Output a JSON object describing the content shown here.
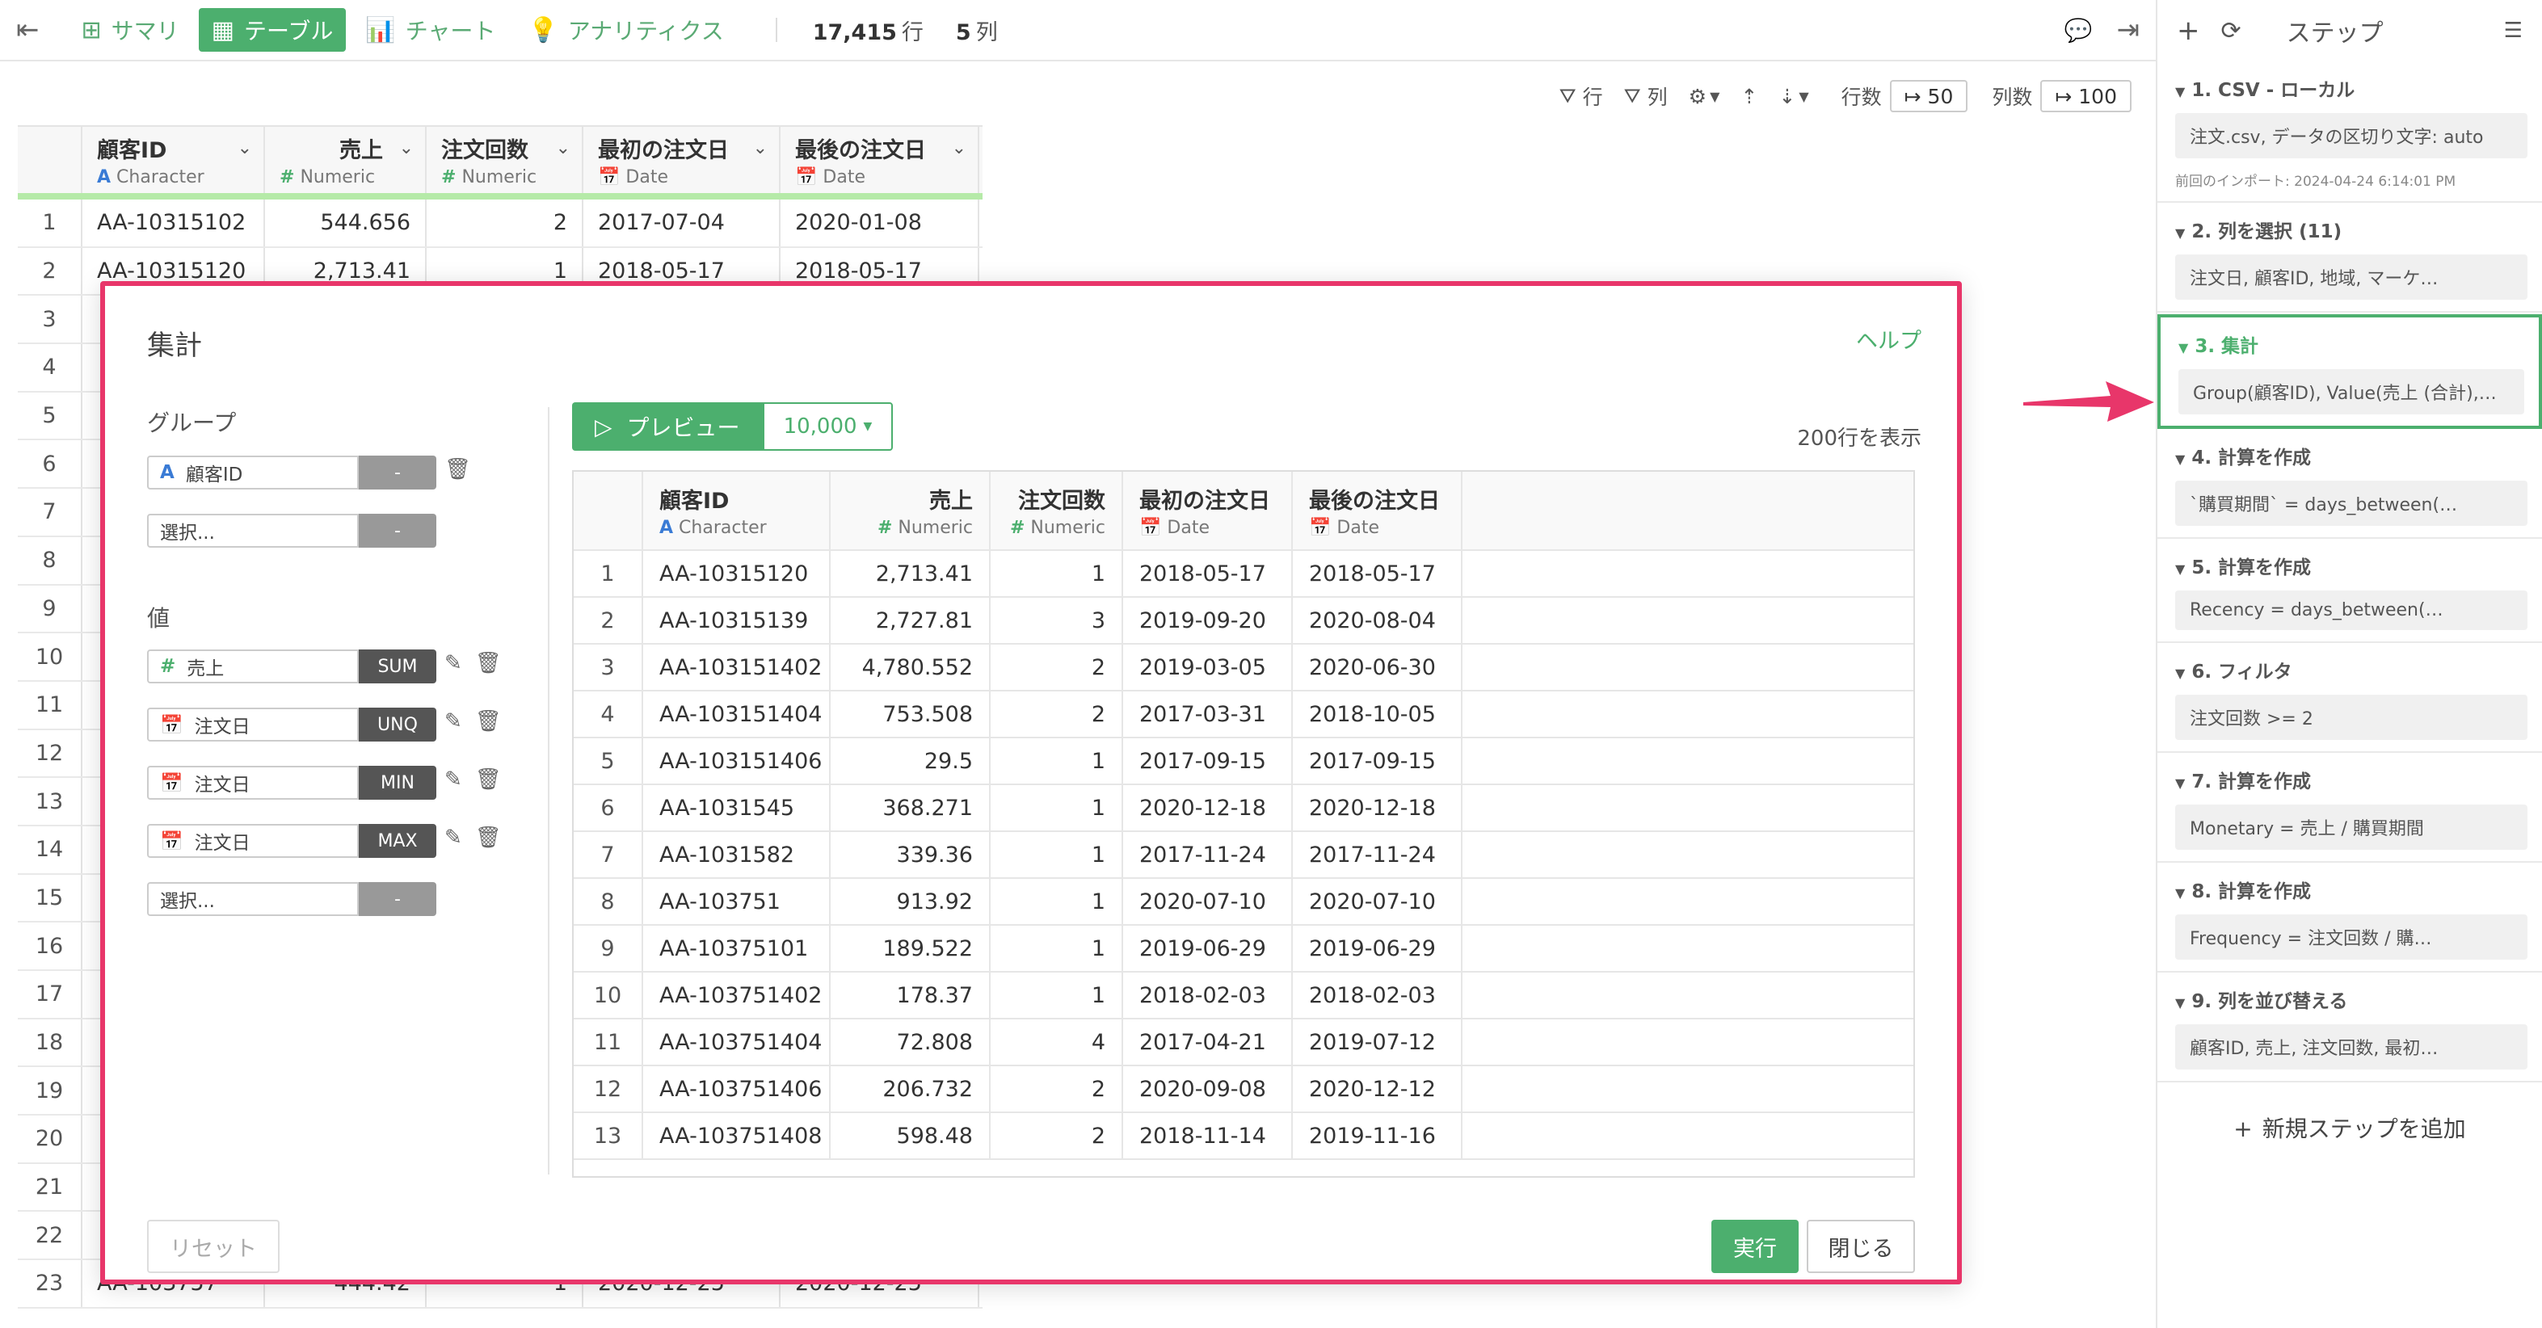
{
  "topbar": {
    "tabs": [
      {
        "icon": "table-grid-icon",
        "label": "サマリ"
      },
      {
        "icon": "table-icon",
        "label": "テーブル"
      },
      {
        "icon": "bar-chart-icon",
        "label": "チャート"
      },
      {
        "icon": "lightbulb-icon",
        "label": "アナリティクス"
      }
    ],
    "rows_count": "17,415",
    "rows_unit": "行",
    "cols_count": "5",
    "cols_unit": "列"
  },
  "toolbar": {
    "row_filter": "行",
    "col_filter": "列",
    "rows_label": "行数",
    "rows_value": "↦ 50",
    "cols_label": "列数",
    "cols_value": "↦ 100"
  },
  "bg_table": {
    "columns": [
      {
        "name": "顧客ID",
        "type": "Character",
        "type_icon": "A"
      },
      {
        "name": "売上",
        "type": "Numeric",
        "type_icon": "#"
      },
      {
        "name": "注文回数",
        "type": "Numeric",
        "type_icon": "#"
      },
      {
        "name": "最初の注文日",
        "type": "Date",
        "type_icon": "📅"
      },
      {
        "name": "最後の注文日",
        "type": "Date",
        "type_icon": "📅"
      }
    ],
    "rows": [
      [
        "1",
        "AA-10315102",
        "544.656",
        "2",
        "2017-07-04",
        "2020-01-08"
      ],
      [
        "2",
        "AA-10315120",
        "2,713.41",
        "1",
        "2018-05-17",
        "2018-05-17"
      ],
      [
        "3",
        "",
        "",
        "",
        "",
        ""
      ],
      [
        "4",
        "",
        "",
        "",
        "",
        ""
      ],
      [
        "5",
        "",
        "",
        "",
        "",
        ""
      ],
      [
        "6",
        "",
        "",
        "",
        "",
        ""
      ],
      [
        "7",
        "",
        "",
        "",
        "",
        ""
      ],
      [
        "8",
        "",
        "",
        "",
        "",
        ""
      ],
      [
        "9",
        "",
        "",
        "",
        "",
        ""
      ],
      [
        "10",
        "",
        "",
        "",
        "",
        ""
      ],
      [
        "11",
        "",
        "",
        "",
        "",
        ""
      ],
      [
        "12",
        "",
        "",
        "",
        "",
        ""
      ],
      [
        "13",
        "",
        "",
        "",
        "",
        ""
      ],
      [
        "14",
        "",
        "",
        "",
        "",
        ""
      ],
      [
        "15",
        "",
        "",
        "",
        "",
        ""
      ],
      [
        "16",
        "",
        "",
        "",
        "",
        ""
      ],
      [
        "17",
        "",
        "",
        "",
        "",
        ""
      ],
      [
        "18",
        "",
        "",
        "",
        "",
        ""
      ],
      [
        "19",
        "",
        "",
        "",
        "",
        ""
      ],
      [
        "20",
        "",
        "",
        "",
        "",
        ""
      ],
      [
        "21",
        "",
        "",
        "",
        "",
        ""
      ],
      [
        "22",
        "",
        "",
        "",
        "",
        ""
      ],
      [
        "23",
        "AA-103757",
        "444.42",
        "1",
        "2020-12-25",
        "2020-12-25"
      ]
    ]
  },
  "sidebar": {
    "title": "ステップ",
    "steps": [
      {
        "title": "1. CSV - ローカル",
        "body": "注文.csv, データの区切り文字: auto",
        "meta": "前回のインポート: 2024-04-24 6:14:01 PM"
      },
      {
        "title": "2. 列を選択 (11)",
        "body": "注文日, 顧客ID, 地域, マーケ…"
      },
      {
        "title": "3. 集計",
        "body": "Group(顧客ID), Value(売上 (合計),注…"
      },
      {
        "title": "4. 計算を作成",
        "body": "`購買期間` = days_between(…"
      },
      {
        "title": "5. 計算を作成",
        "body": "Recency = days_between(…"
      },
      {
        "title": "6. フィルタ",
        "body": "注文回数 >= 2"
      },
      {
        "title": "7. 計算を作成",
        "body": "Monetary = 売上 / 購買期間"
      },
      {
        "title": "8. 計算を作成",
        "body": "Frequency = 注文回数 / 購…"
      },
      {
        "title": "9. 列を並び替える",
        "body": "顧客ID, 売上, 注文回数, 最初…"
      }
    ],
    "add_step": "新規ステップを追加"
  },
  "modal": {
    "title": "集計",
    "help": "ヘルプ",
    "group_label": "グループ",
    "value_label": "値",
    "groups": [
      {
        "type_icon": "A",
        "field": "顧客ID",
        "action": "-"
      },
      {
        "type_icon": "",
        "field": "選択...",
        "action": "-"
      }
    ],
    "values": [
      {
        "type_icon": "#",
        "field": "売上",
        "action": "SUM"
      },
      {
        "type_icon": "📅",
        "field": "注文日",
        "action": "UNQ"
      },
      {
        "type_icon": "📅",
        "field": "注文日",
        "action": "MIN"
      },
      {
        "type_icon": "📅",
        "field": "注文日",
        "action": "MAX"
      },
      {
        "type_icon": "",
        "field": "選択...",
        "action": "-"
      }
    ],
    "preview_button": "プレビュー",
    "preview_count": "10,000",
    "rows_shown": "200行を表示",
    "reset": "リセット",
    "run": "実行",
    "close": "閉じる",
    "preview_table": {
      "columns": [
        {
          "name": "顧客ID",
          "type": "Character",
          "type_icon": "A"
        },
        {
          "name": "売上",
          "type": "Numeric",
          "type_icon": "#"
        },
        {
          "name": "注文回数",
          "type": "Numeric",
          "type_icon": "#"
        },
        {
          "name": "最初の注文日",
          "type": "Date",
          "type_icon": "📅"
        },
        {
          "name": "最後の注文日",
          "type": "Date",
          "type_icon": "📅"
        }
      ],
      "rows": [
        [
          "1",
          "AA-10315120",
          "2,713.41",
          "1",
          "2018-05-17",
          "2018-05-17"
        ],
        [
          "2",
          "AA-10315139",
          "2,727.81",
          "3",
          "2019-09-20",
          "2020-08-04"
        ],
        [
          "3",
          "AA-103151402",
          "4,780.552",
          "2",
          "2019-03-05",
          "2020-06-30"
        ],
        [
          "4",
          "AA-103151404",
          "753.508",
          "2",
          "2017-03-31",
          "2018-10-05"
        ],
        [
          "5",
          "AA-103151406",
          "29.5",
          "1",
          "2017-09-15",
          "2017-09-15"
        ],
        [
          "6",
          "AA-1031545",
          "368.271",
          "1",
          "2020-12-18",
          "2020-12-18"
        ],
        [
          "7",
          "AA-1031582",
          "339.36",
          "1",
          "2017-11-24",
          "2017-11-24"
        ],
        [
          "8",
          "AA-103751",
          "913.92",
          "1",
          "2020-07-10",
          "2020-07-10"
        ],
        [
          "9",
          "AA-10375101",
          "189.522",
          "1",
          "2019-06-29",
          "2019-06-29"
        ],
        [
          "10",
          "AA-103751402",
          "178.37",
          "1",
          "2018-02-03",
          "2018-02-03"
        ],
        [
          "11",
          "AA-103751404",
          "72.808",
          "4",
          "2017-04-21",
          "2019-07-12"
        ],
        [
          "12",
          "AA-103751406",
          "206.732",
          "2",
          "2020-09-08",
          "2020-12-12"
        ],
        [
          "13",
          "AA-103751408",
          "598.48",
          "2",
          "2018-11-14",
          "2019-11-16"
        ]
      ]
    }
  }
}
